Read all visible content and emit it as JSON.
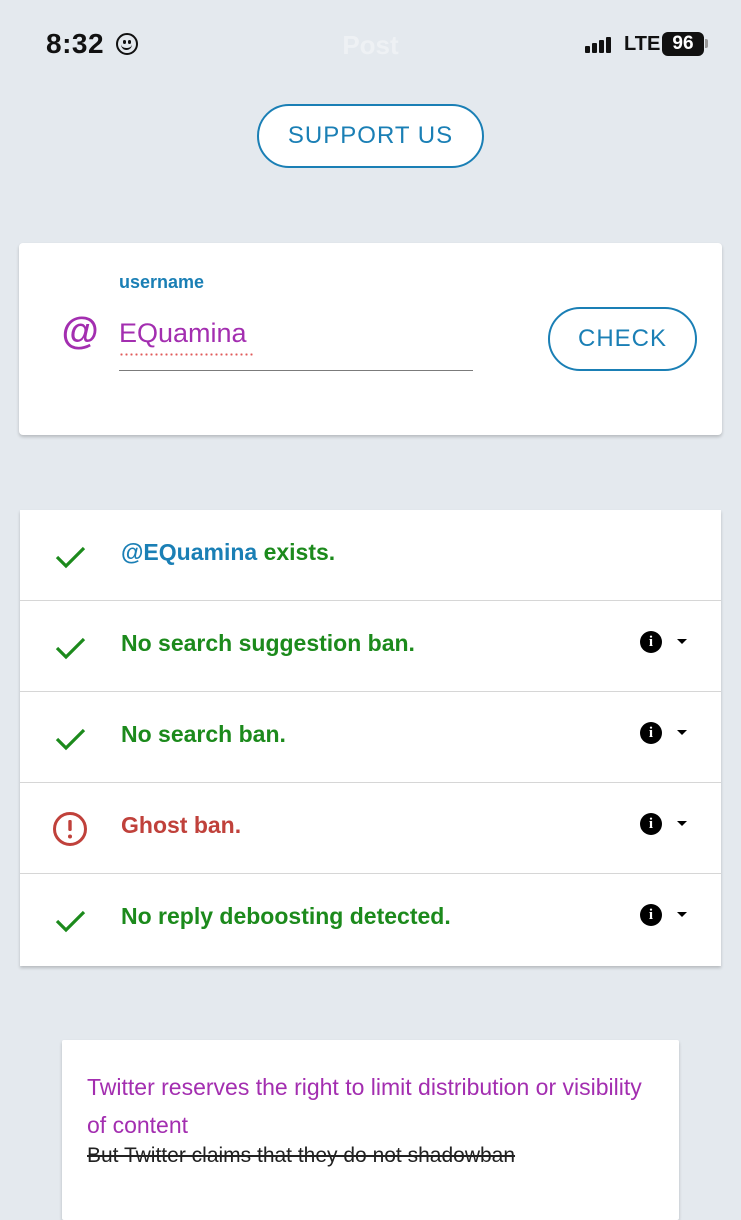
{
  "status_bar": {
    "time": "8:32",
    "title": "Post",
    "network": "LTE",
    "battery": "96"
  },
  "support_button": {
    "label": "SUPPORT US"
  },
  "search": {
    "at_symbol": "@",
    "field_label": "username",
    "username_value": "EQuamina",
    "check_label": "CHECK"
  },
  "results": [
    {
      "status": "ok",
      "handle": "@EQuamina",
      "text": " exists.",
      "has_info": false
    },
    {
      "status": "ok",
      "text": "No search suggestion ban.",
      "has_info": true
    },
    {
      "status": "ok",
      "text": "No search ban.",
      "has_info": true
    },
    {
      "status": "error",
      "text": "Ghost ban.",
      "has_info": true
    },
    {
      "status": "ok",
      "text": "No reply deboosting detected.",
      "has_info": true
    }
  ],
  "notice": {
    "title": "Twitter reserves the right to limit distribution or visibility of content",
    "subtitle": "But Twitter claims that they do not shadowban"
  },
  "colors": {
    "accent_blue": "#1a7fb5",
    "accent_purple": "#a32eb0",
    "ok_green": "#1c8a1c",
    "error_red": "#c0413b"
  },
  "icons": {
    "ok": "check-icon",
    "error": "alert-circle-icon",
    "info": "info-icon",
    "expand": "caret-down-icon"
  }
}
